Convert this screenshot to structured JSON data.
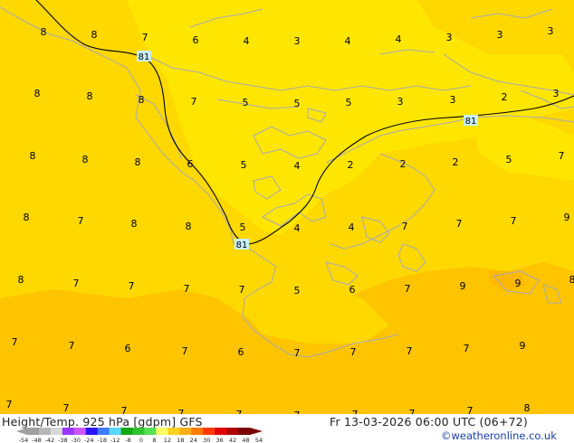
{
  "footer": {
    "title": "Height/Temp. 925 hPa [gdpm] GFS",
    "valid_time": "Fr 13-03-2026 06:00 UTC (06+72)",
    "credit": "©weatheronline.co.uk"
  },
  "colorbar": {
    "ticks": [
      "-54",
      "-48",
      "-42",
      "-38",
      "-30",
      "-24",
      "-18",
      "-12",
      "-8",
      "0",
      "8",
      "12",
      "18",
      "24",
      "30",
      "36",
      "42",
      "48",
      "54"
    ],
    "colors": [
      "#a0a0a0",
      "#b8b8b8",
      "#d8d8d8",
      "#9b36ff",
      "#cc55ff",
      "#2c14ff",
      "#3f7bff",
      "#5ad7ff",
      "#15a815",
      "#2fc42f",
      "#55e055",
      "#ffff66",
      "#ffd21f",
      "#ffad14",
      "#ff7a00",
      "#ff3a00",
      "#e00000",
      "#b00000",
      "#7a0000"
    ]
  },
  "colors": {
    "pale_yellow": "#ffe600",
    "yellow": "#ffd800",
    "orange": "#ffc400",
    "coastline": "#a9a9b5",
    "contour": "#000000"
  },
  "contour_labels": [
    "81",
    "81",
    "81"
  ],
  "temperature_labels": [
    "8",
    "8",
    "7",
    "6",
    "4",
    "3",
    "4",
    "4",
    "3",
    "3",
    "3",
    "8",
    "8",
    "8",
    "7",
    "5",
    "5",
    "5",
    "3",
    "3",
    "2",
    "3",
    "8",
    "8",
    "8",
    "6",
    "5",
    "4",
    "2",
    "2",
    "2",
    "5",
    "7",
    "8",
    "7",
    "8",
    "8",
    "5",
    "4",
    "4",
    "7",
    "7",
    "7",
    "9",
    "8",
    "7",
    "7",
    "7",
    "7",
    "5",
    "6",
    "7",
    "9",
    "9",
    "8",
    "7",
    "7",
    "6",
    "7",
    "6",
    "7",
    "7",
    "7",
    "7",
    "9",
    "7",
    "7",
    "7",
    "7",
    "7",
    "7",
    "7",
    "7",
    "7",
    "8"
  ]
}
